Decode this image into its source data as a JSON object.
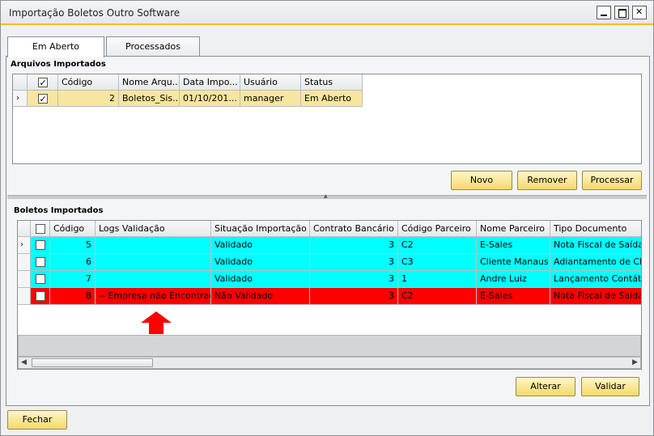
{
  "window": {
    "title": "Importação Boletos Outro Software"
  },
  "tabs": [
    {
      "label": "Em Aberto",
      "active": true
    },
    {
      "label": "Processados",
      "active": false
    }
  ],
  "arquivos": {
    "section_label": "Arquivos Importados",
    "columns": [
      "Código",
      "Nome Arqu...",
      "Data Impo...",
      "Usuário",
      "Status"
    ],
    "rows": [
      {
        "checked": true,
        "codigo": "2",
        "nome": "Boletos_Sis...",
        "data": "01/10/201...",
        "usuario": "manager",
        "status": "Em Aberto"
      }
    ],
    "buttons": {
      "novo": "Novo",
      "remover": "Remover",
      "processar": "Processar"
    }
  },
  "boletos": {
    "section_label": "Boletos Importados",
    "columns": [
      "Código",
      "Logs Validação",
      "Situação Importação",
      "Contrato Bancário",
      "Código Parceiro",
      "Nome Parceiro",
      "Tipo Documento"
    ],
    "rows": [
      {
        "codigo": "5",
        "logs": "",
        "situacao": "Validado",
        "contrato": "3",
        "cod_parceiro": "C2",
        "nome_parceiro": "E-Sales",
        "tipo": "Nota Fiscal de Saída",
        "color": "#00ffff"
      },
      {
        "codigo": "6",
        "logs": "",
        "situacao": "Validado",
        "contrato": "3",
        "cod_parceiro": "C3",
        "nome_parceiro": "Cliente Manaus",
        "tipo": "Adiantamento de Clien",
        "color": "#00ffff"
      },
      {
        "codigo": "7",
        "logs": "",
        "situacao": "Validado",
        "contrato": "3",
        "cod_parceiro": "1",
        "nome_parceiro": "Andre Luiz",
        "tipo": "Lançamento Contábil M",
        "color": "#00ffff"
      },
      {
        "codigo": "8",
        "logs": "-- Empresa não Encontrada!",
        "situacao": "Não Validado",
        "contrato": "3",
        "cod_parceiro": "C2",
        "nome_parceiro": "E-Sales",
        "tipo": "Nota Fiscal de Saída",
        "color": "#ff0000"
      }
    ],
    "buttons": {
      "alterar": "Alterar",
      "validar": "Validar"
    }
  },
  "footer": {
    "fechar": "Fechar"
  },
  "colors": {
    "accent": "#f2c200",
    "valid_row": "#00ffff",
    "invalid_row": "#ff0000",
    "selected_row": "#f7e6a1"
  }
}
